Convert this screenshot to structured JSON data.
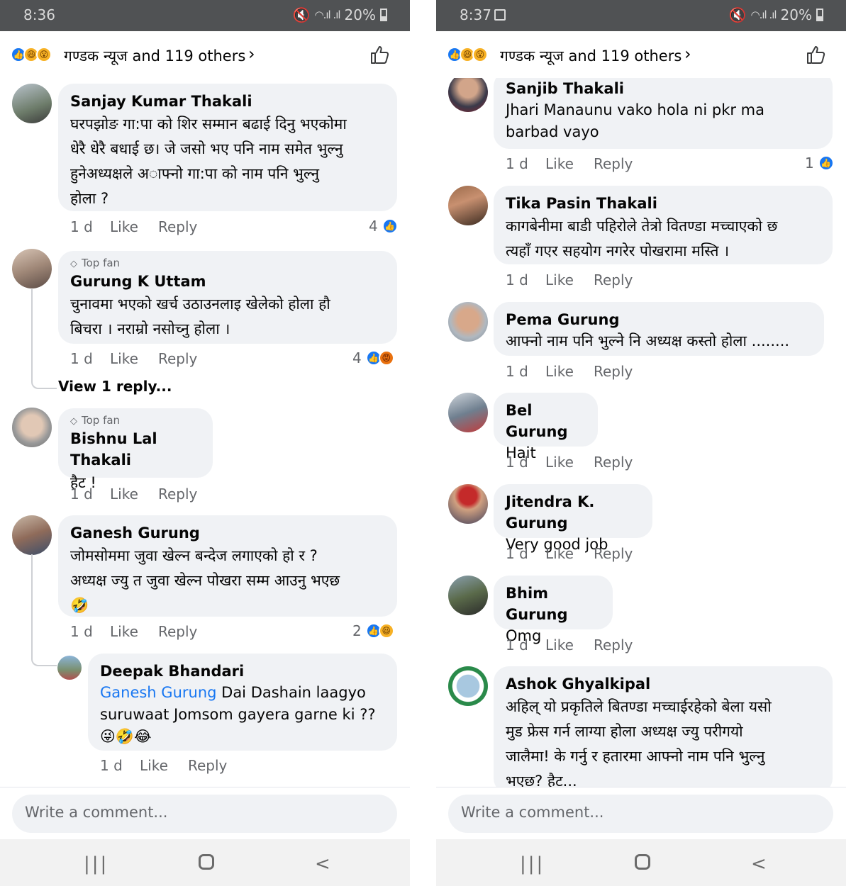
{
  "colors": {
    "status_bar": "#505254",
    "bubble": "#f0f2f5",
    "link_blue": "#1877f2",
    "meta_gray": "#65676b",
    "nav_bar": "#f2f2f2"
  },
  "left": {
    "status": {
      "time": "8:36",
      "battery": "20%"
    },
    "reactions_header": {
      "summary": "गण्डक न्यूज and 119 others",
      "chevron": "›"
    },
    "comments": [
      {
        "name": "Sanjay Kumar Thakali",
        "lines": [
          "घरपझोङ गा:पा को शिर सम्मान बढाई दिनु भएकोमा",
          "धेरै धेरै बधाई  छ। जे जसो भए  पनि नाम समेत भुल्नु",
          "हुनेअध्यक्षले अाफ्नो गा:पा को नाम पनि भुल्नु",
          "होला ?"
        ],
        "time": "1 d",
        "like": "Like",
        "reply": "Reply",
        "reactions": "4"
      },
      {
        "badge": "Top fan",
        "name": "Gurung K Uttam",
        "lines": [
          "चुनावमा भएको खर्च उठाउनलाइ खेलेको होला हौ",
          "बिचरा । नराम्रो नसोच्नु होला ।"
        ],
        "time": "1 d",
        "like": "Like",
        "reply": "Reply",
        "reactions": "4",
        "view_replies": "View 1 reply..."
      },
      {
        "badge": "Top fan",
        "name": "Bishnu Lal Thakali",
        "lines": [
          "हैट !"
        ],
        "time": "1 d",
        "like": "Like",
        "reply": "Reply"
      },
      {
        "name": "Ganesh Gurung",
        "lines": [
          "जोमसोममा जुवा खेल्न बन्देज लगाएको हो र ?",
          "अध्यक्ष ज्यु त जुवा खेल्न पोखरा सम्म आउनु भएछ",
          "🤣"
        ],
        "time": "1 d",
        "like": "Like",
        "reply": "Reply",
        "reactions": "2"
      },
      {
        "name": "Deepak Bhandari",
        "mention": "Ganesh Gurung",
        "lines": [
          " Dai Dashain laagyo",
          "suruwaat Jomsom gayera garne ki ??",
          "😜🤣😂"
        ],
        "time": "1 d",
        "like": "Like",
        "reply": "Reply"
      }
    ],
    "composer_placeholder": "Write a comment..."
  },
  "right": {
    "status": {
      "time": "8:37",
      "battery": "20%"
    },
    "reactions_header": {
      "summary": "गण्डक न्यूज and 119 others",
      "chevron": "›"
    },
    "comments": [
      {
        "name": "Sanjib Thakali",
        "lines": [
          "Jhari Manaunu vako hola ni pkr ma",
          "barbad vayo"
        ],
        "time": "1 d",
        "like": "Like",
        "reply": "Reply",
        "reactions": "1"
      },
      {
        "name": "Tika Pasin Thakali",
        "lines": [
          "कागबेनीमा बाडी पहिरोले तेत्रो वितण्डा मच्चाएको छ",
          "त्यहाँ गएर सहयोग नगरेर पोखरामा मस्ति ।"
        ],
        "time": "1 d",
        "like": "Like",
        "reply": "Reply"
      },
      {
        "name": "Pema Gurung",
        "lines": [
          "आफ्नो नाम पनि भुल्ने नि अध्यक्ष कस्तो होला ........"
        ],
        "time": "1 d",
        "like": "Like",
        "reply": "Reply"
      },
      {
        "name": "Bel Gurung",
        "lines": [
          "Hait"
        ],
        "time": "1 d",
        "like": "Like",
        "reply": "Reply"
      },
      {
        "name": "Jitendra K. Gurung",
        "lines": [
          "Very good job"
        ],
        "time": "1 d",
        "like": "Like",
        "reply": "Reply"
      },
      {
        "name": "Bhim Gurung",
        "lines": [
          "Omg"
        ],
        "time": "1 d",
        "like": "Like",
        "reply": "Reply"
      },
      {
        "name": "Ashok Ghyalkipal",
        "lines": [
          "अहिल् यो प्रकृतिले बितण्डा मच्चाईरहेको बेला यसो",
          "मुड फ्रेस गर्न लाग्या होला अध्यक्ष ज्यु परीगयो",
          "जालैमा! के गर्नु र हतारमा आफ्नो नाम पनि भुल्नु",
          "भएछ? हैट..."
        ]
      }
    ],
    "composer_placeholder": "Write a comment..."
  },
  "icons": {
    "like_reaction": "like-reaction-icon",
    "haha_reaction": "haha-reaction-icon",
    "wow_reaction": "wow-reaction-icon",
    "angry_reaction": "angry-reaction-icon",
    "thumbs_up": "thumbs-up-icon",
    "top_fan": "diamond-icon"
  }
}
